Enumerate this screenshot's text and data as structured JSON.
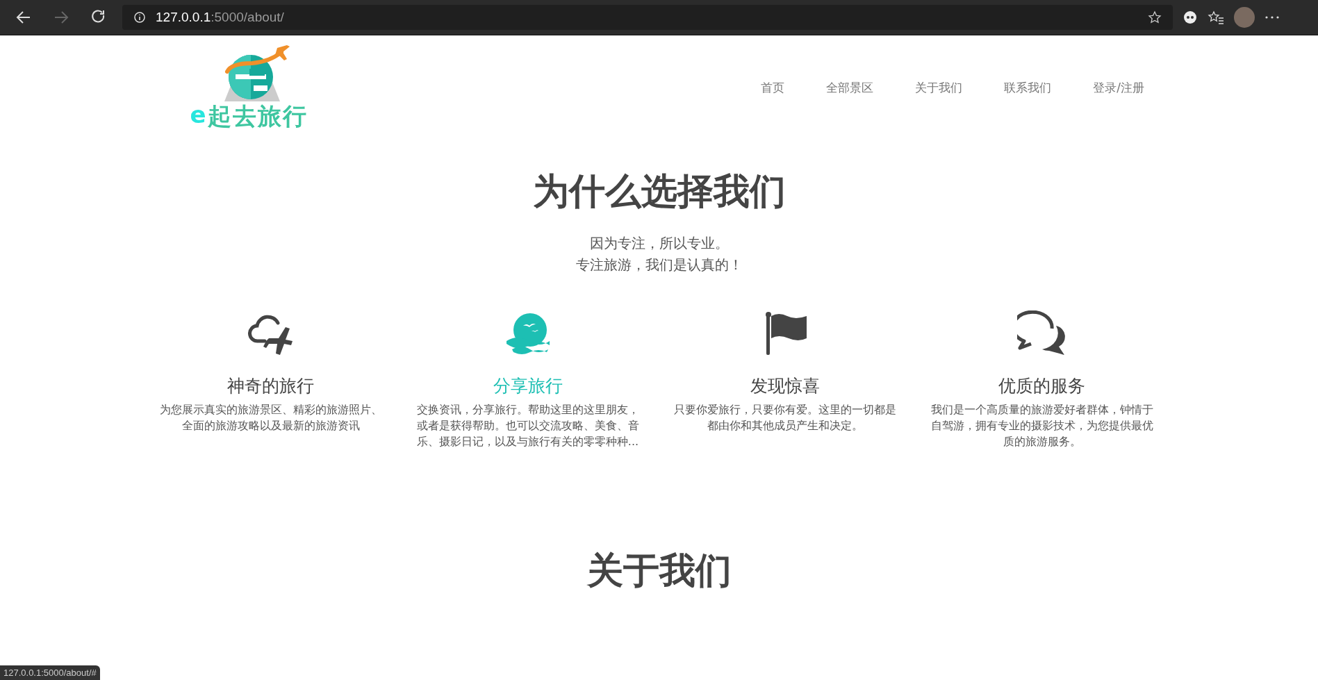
{
  "browser": {
    "url_host": "127.0.0.1",
    "url_path": ":5000/about/"
  },
  "logo": {
    "mark": "e",
    "name": "起去旅行"
  },
  "nav": [
    {
      "label": "首页"
    },
    {
      "label": "全部景区"
    },
    {
      "label": "关于我们"
    },
    {
      "label": "联系我们"
    },
    {
      "label": "登录/注册"
    }
  ],
  "hero": {
    "title": "为什么选择我们",
    "lines": [
      "因为专注，所以专业。",
      "专注旅游，我们是认真的！"
    ]
  },
  "features": [
    {
      "kind": "cloud-plane",
      "title": "神奇的旅行",
      "text": "为您展示真实的旅游景区、精彩的旅游照片、全面的旅游攻略以及最新的旅游资讯",
      "highlighted": false
    },
    {
      "kind": "sea",
      "title": "分享旅行",
      "text": "交换资讯，分享旅行。帮助这里的这里朋友，或者是获得帮助。也可以交流攻略、美食、音乐、摄影日记，以及与旅行有关的零零种种...",
      "highlighted": true
    },
    {
      "kind": "flag",
      "title": "发现惊喜",
      "text": "只要你爱旅行，只要你有爱。这里的一切都是都由你和其他成员产生和决定。",
      "highlighted": false
    },
    {
      "kind": "chat",
      "title": "优质的服务",
      "text": "我们是一个高质量的旅游爱好者群体，钟情于自驾游，拥有专业的摄影技术，为您提供最优质的旅游服务。",
      "highlighted": false
    }
  ],
  "about": {
    "title": "关于我们"
  },
  "status_bar": {
    "url": "127.0.0.1:5000/about/#"
  }
}
